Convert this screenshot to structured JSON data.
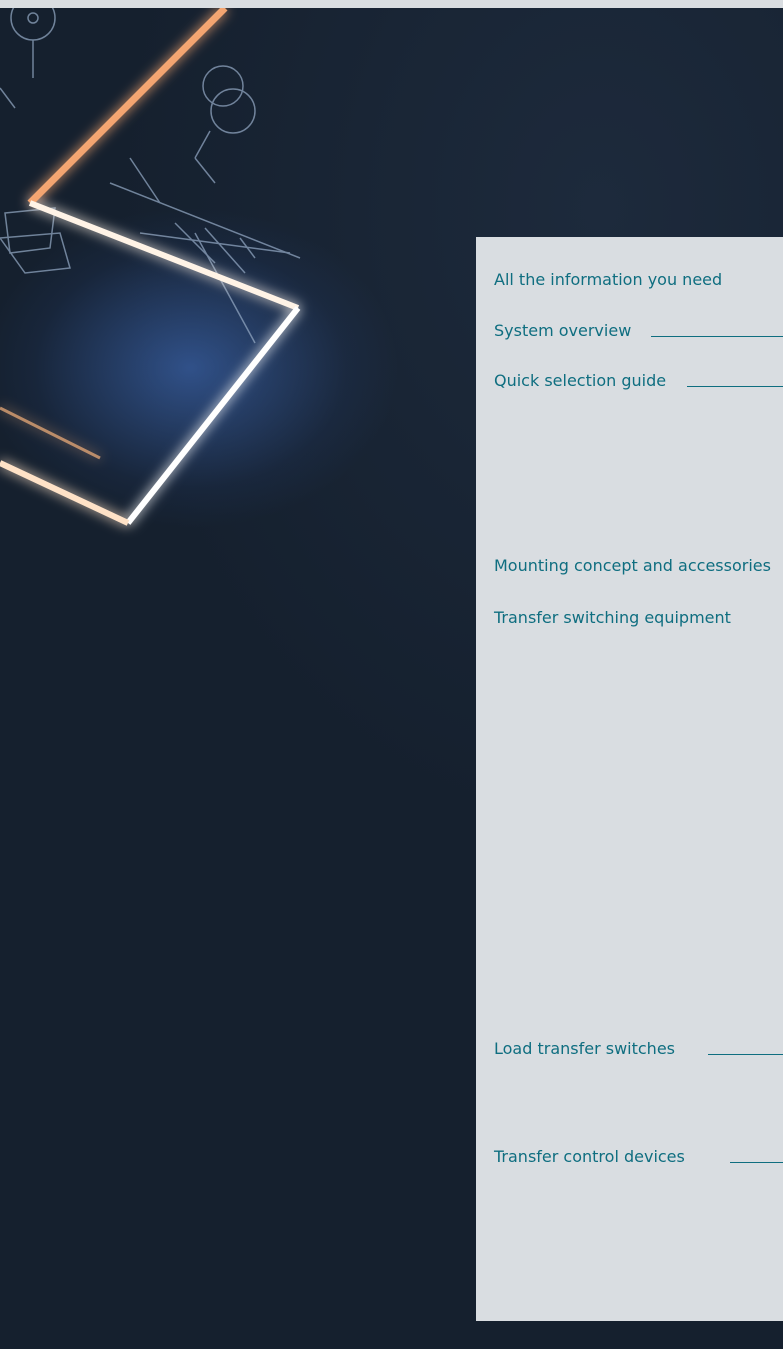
{
  "toc": {
    "items": [
      {
        "label": "All the information you need"
      },
      {
        "label": "System overview"
      },
      {
        "label": "Quick selection guide"
      },
      {
        "label": "Mounting concept and accessories"
      },
      {
        "label": "Transfer switching equipment"
      },
      {
        "label": "Load transfer switches"
      },
      {
        "label": "Transfer control devices"
      }
    ]
  },
  "colors": {
    "panel_bg": "#d9dde1",
    "link": "#0f6e80",
    "background": "#17212f",
    "glow_orange": "#f3a36a",
    "glow_blue": "#5a8fe0"
  }
}
